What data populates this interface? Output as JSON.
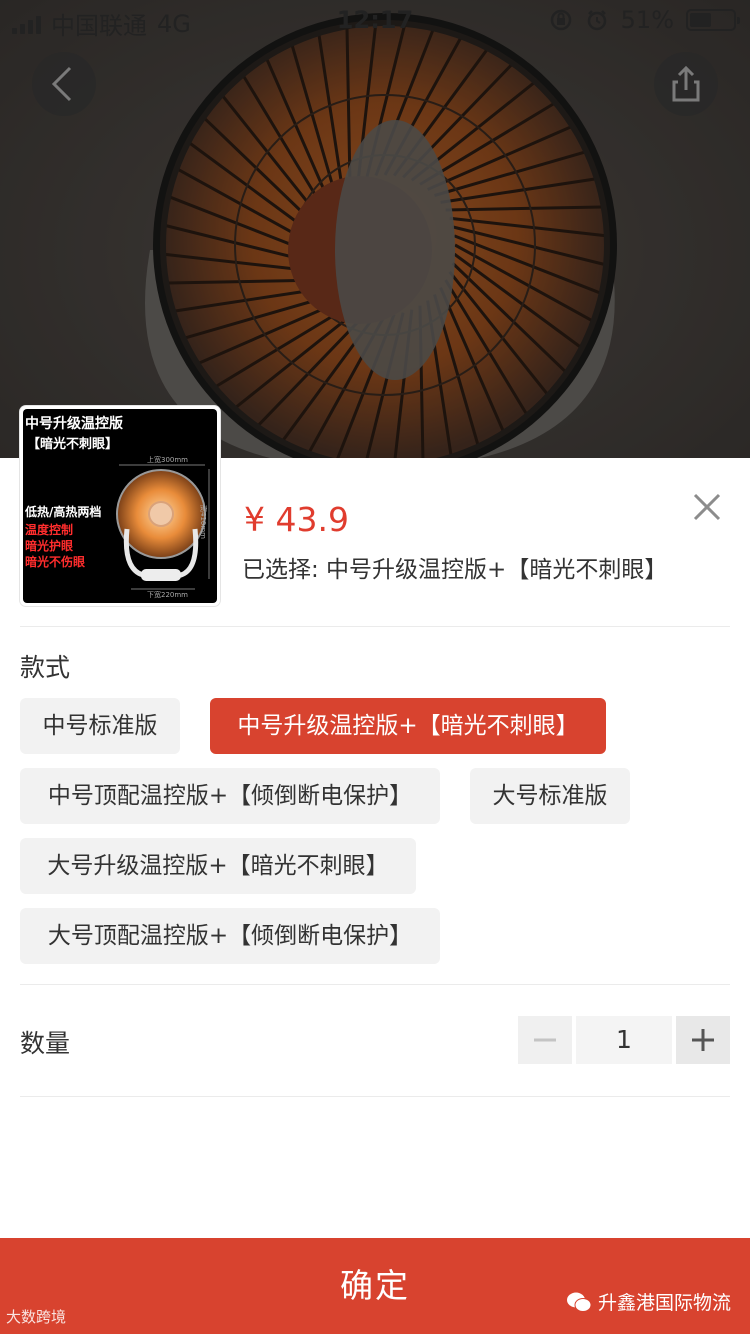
{
  "status_bar": {
    "carrier": "中国联通",
    "network": "4G",
    "time": "12:17",
    "battery": "51%",
    "battery_level": 0.51
  },
  "product": {
    "thumb_title": "中号升级温控版",
    "thumb_subtitle": "【暗光不刺眼】",
    "thumb_feature_white": "低热/高热两档",
    "thumb_features_red": [
      "温度控制",
      "暗光护眼",
      "暗光不伤眼"
    ],
    "thumb_dim_top": "上宽300mm",
    "thumb_dim_side": "高410mm",
    "thumb_dim_bottom": "下宽220mm",
    "price": "¥ 43.9",
    "selected_text": "已选择: 中号升级温控版+【暗光不刺眼】"
  },
  "style_section": {
    "label": "款式",
    "options": [
      {
        "label": "中号标准版",
        "selected": false
      },
      {
        "label": "中号升级温控版+【暗光不刺眼】",
        "selected": true
      },
      {
        "label": "中号顶配温控版+【倾倒断电保护】",
        "selected": false
      },
      {
        "label": "大号标准版",
        "selected": false
      },
      {
        "label": "大号升级温控版+【暗光不刺眼】",
        "selected": false
      },
      {
        "label": "大号顶配温控版+【倾倒断电保护】",
        "selected": false
      }
    ]
  },
  "quantity_section": {
    "label": "数量",
    "value": "1"
  },
  "confirm_label": "确定",
  "watermark_left": "大数跨境",
  "watermark_right": "升鑫港国际物流",
  "colors": {
    "accent": "#d8432f",
    "price": "#e03c2e"
  }
}
